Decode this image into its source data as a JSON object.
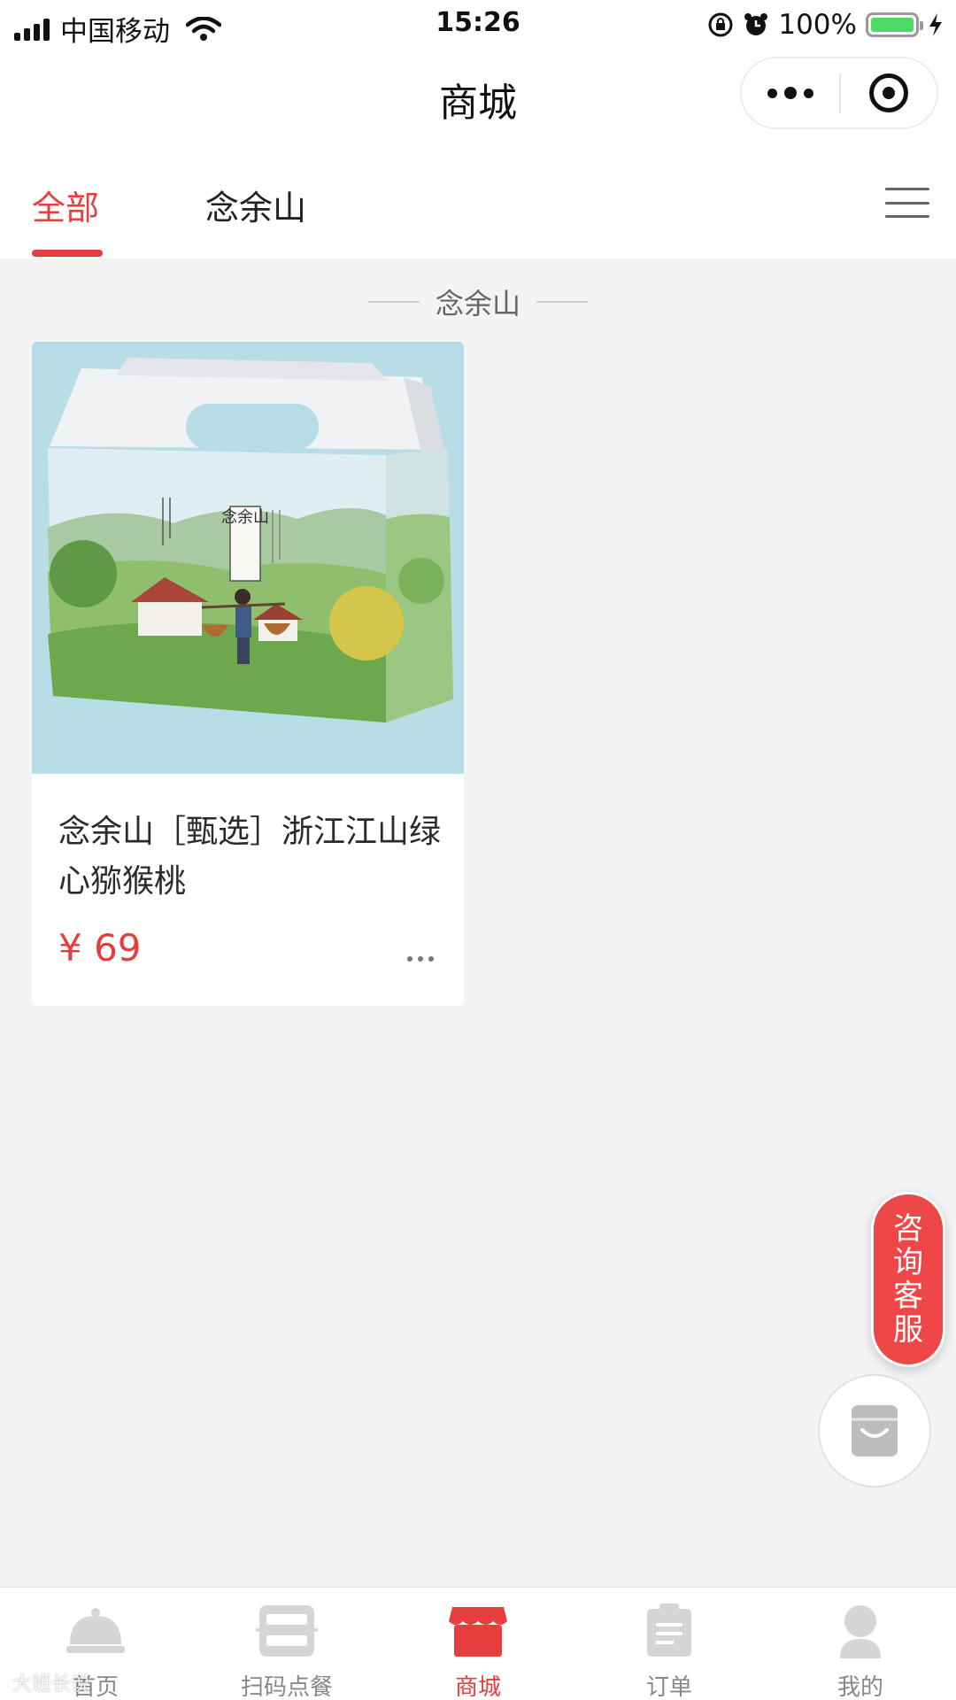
{
  "status_bar": {
    "carrier": "中国移动",
    "time": "15:26",
    "battery": "100%",
    "battery_level": 1.0
  },
  "nav": {
    "title": "商城"
  },
  "tabs": [
    {
      "label": "全部",
      "active": true
    },
    {
      "label": "念余山",
      "active": false
    }
  ],
  "section": {
    "title": "念余山"
  },
  "products": [
    {
      "name": "念余山［甄选］浙江江山绿心猕猴桃",
      "price": "¥ 69",
      "box_label": "念余山"
    }
  ],
  "floating": {
    "service_label": "咨询客服"
  },
  "bottom_tabs": [
    {
      "label": "首页",
      "icon": "service-bell-icon",
      "active": false
    },
    {
      "label": "扫码点餐",
      "icon": "scan-order-icon",
      "active": false
    },
    {
      "label": "商城",
      "icon": "store-icon",
      "active": true
    },
    {
      "label": "订单",
      "icon": "order-list-icon",
      "active": false
    },
    {
      "label": "我的",
      "icon": "user-profile-icon",
      "active": false
    }
  ],
  "watermark": "大班长说",
  "colors": {
    "accent": "#e63e3e",
    "background": "#f4f3f5",
    "inactive_icon": "#d6d6d6"
  }
}
